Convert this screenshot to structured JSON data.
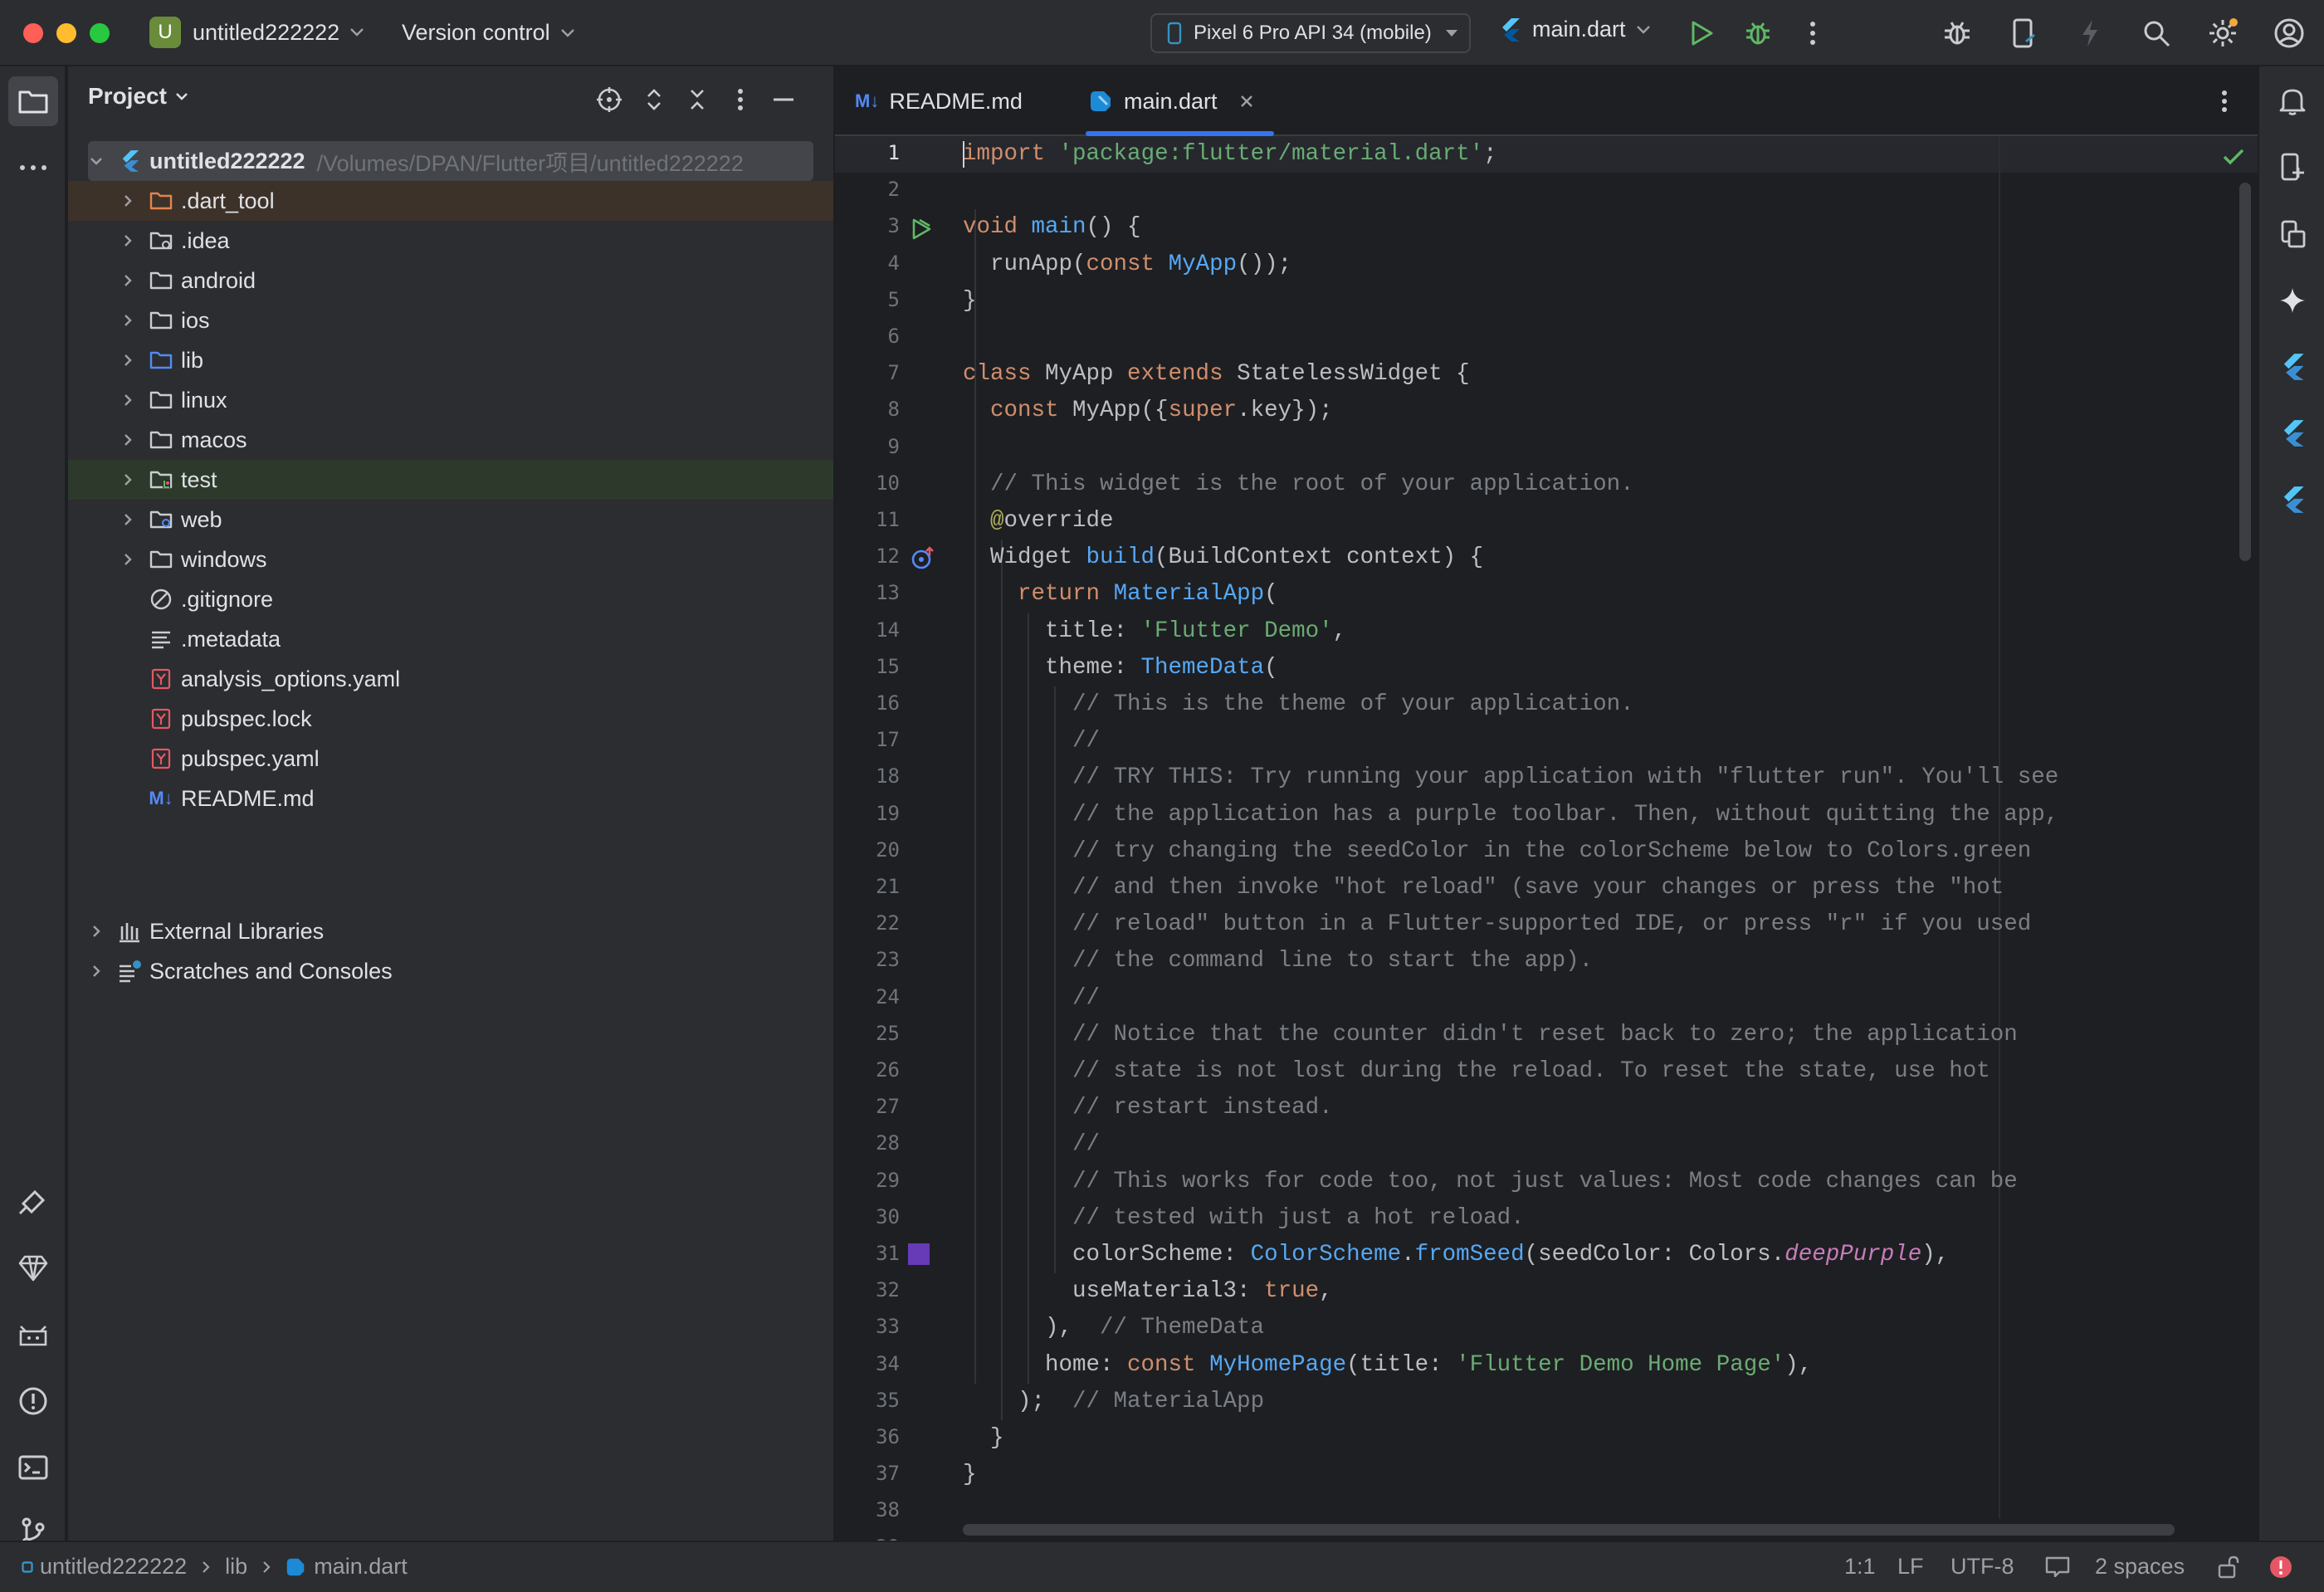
{
  "titlebar": {
    "project_initial": "U",
    "project_name": "untitled222222",
    "version_control": "Version control",
    "device": "Pixel 6 Pro API 34 (mobile)",
    "run_config": "main.dart"
  },
  "project_panel": {
    "title": "Project",
    "root": {
      "name": "untitled222222",
      "path": "/Volumes/DPAN/Flutter项目/untitled222222"
    },
    "items": [
      {
        "label": ".dart_tool",
        "icon": "folder-excluded-icon",
        "expandable": true
      },
      {
        "label": ".idea",
        "icon": "folder-settings-icon",
        "expandable": true
      },
      {
        "label": "android",
        "icon": "folder-icon",
        "expandable": true
      },
      {
        "label": "ios",
        "icon": "folder-icon",
        "expandable": true
      },
      {
        "label": "lib",
        "icon": "folder-source-icon",
        "expandable": true
      },
      {
        "label": "linux",
        "icon": "folder-icon",
        "expandable": true
      },
      {
        "label": "macos",
        "icon": "folder-icon",
        "expandable": true
      },
      {
        "label": "test",
        "icon": "folder-test-icon",
        "expandable": true
      },
      {
        "label": "web",
        "icon": "folder-web-icon",
        "expandable": true
      },
      {
        "label": "windows",
        "icon": "folder-icon",
        "expandable": true
      },
      {
        "label": ".gitignore",
        "icon": "ignore-file-icon",
        "expandable": false
      },
      {
        "label": ".metadata",
        "icon": "text-file-icon",
        "expandable": false
      },
      {
        "label": "analysis_options.yaml",
        "icon": "yaml-file-icon",
        "expandable": false
      },
      {
        "label": "pubspec.lock",
        "icon": "yaml-file-icon",
        "expandable": false
      },
      {
        "label": "pubspec.yaml",
        "icon": "yaml-file-icon",
        "expandable": false
      },
      {
        "label": "README.md",
        "icon": "markdown-file-icon",
        "expandable": false
      }
    ],
    "external_libraries": "External Libraries",
    "scratches": "Scratches and Consoles"
  },
  "editor": {
    "tabs": [
      {
        "label": "README.md",
        "icon_text": "M↓",
        "active": false
      },
      {
        "label": "main.dart",
        "active": true
      }
    ],
    "lines": [
      [
        [
          "kw",
          "import"
        ],
        [
          "",
          " "
        ],
        [
          "str",
          "'package:flutter/material.dart'"
        ],
        [
          "",
          ";"
        ]
      ],
      [],
      [
        [
          "kw",
          "void"
        ],
        [
          "",
          " "
        ],
        [
          "fn",
          "main"
        ],
        [
          "",
          "() {"
        ]
      ],
      [
        [
          "",
          "  runApp("
        ],
        [
          "kw",
          "const"
        ],
        [
          "",
          " "
        ],
        [
          "fn",
          "MyApp"
        ],
        [
          "",
          "());"
        ]
      ],
      [
        [
          "",
          "}"
        ]
      ],
      [],
      [
        [
          "kw",
          "class"
        ],
        [
          "",
          " MyApp "
        ],
        [
          "kw",
          "extends"
        ],
        [
          "",
          " StatelessWidget {"
        ]
      ],
      [
        [
          "",
          "  "
        ],
        [
          "kw",
          "const"
        ],
        [
          "",
          " MyApp({"
        ],
        [
          "kw",
          "super"
        ],
        [
          "",
          ".key});"
        ]
      ],
      [],
      [
        [
          "cm",
          "  // This widget is the root of your application."
        ]
      ],
      [
        [
          "",
          "  "
        ],
        [
          "ann",
          "@"
        ],
        [
          "",
          "override"
        ]
      ],
      [
        [
          "",
          "  Widget "
        ],
        [
          "fn",
          "build"
        ],
        [
          "",
          "(BuildContext context) {"
        ]
      ],
      [
        [
          "",
          "    "
        ],
        [
          "kw",
          "return"
        ],
        [
          "",
          " "
        ],
        [
          "fn",
          "MaterialApp"
        ],
        [
          "",
          "("
        ]
      ],
      [
        [
          "",
          "      title: "
        ],
        [
          "str",
          "'Flutter Demo'"
        ],
        [
          "",
          ","
        ]
      ],
      [
        [
          "",
          "      theme: "
        ],
        [
          "fn",
          "ThemeData"
        ],
        [
          "",
          "("
        ]
      ],
      [
        [
          "cm",
          "        // This is the theme of your application."
        ]
      ],
      [
        [
          "cm",
          "        //"
        ]
      ],
      [
        [
          "cm",
          "        // TRY THIS: Try running your application with \"flutter run\". You'll see"
        ]
      ],
      [
        [
          "cm",
          "        // the application has a purple toolbar. Then, without quitting the app,"
        ]
      ],
      [
        [
          "cm",
          "        // try changing the seedColor in the colorScheme below to Colors.green"
        ]
      ],
      [
        [
          "cm",
          "        // and then invoke \"hot reload\" (save your changes or press the \"hot"
        ]
      ],
      [
        [
          "cm",
          "        // reload\" button in a Flutter-supported IDE, or press \"r\" if you used"
        ]
      ],
      [
        [
          "cm",
          "        // the command line to start the app)."
        ]
      ],
      [
        [
          "cm",
          "        //"
        ]
      ],
      [
        [
          "cm",
          "        // Notice that the counter didn't reset back to zero; the application"
        ]
      ],
      [
        [
          "cm",
          "        // state is not lost during the reload. To reset the state, use hot"
        ]
      ],
      [
        [
          "cm",
          "        // restart instead."
        ]
      ],
      [
        [
          "cm",
          "        //"
        ]
      ],
      [
        [
          "cm",
          "        // This works for code too, not just values: Most code changes can be"
        ]
      ],
      [
        [
          "cm",
          "        // tested with just a hot reload."
        ]
      ],
      [
        [
          "",
          "        colorScheme: "
        ],
        [
          "fn",
          "ColorScheme"
        ],
        [
          "",
          "."
        ],
        [
          "fn",
          "fromSeed"
        ],
        [
          "",
          "(seedColor: Colors."
        ],
        [
          "it",
          "deepPurple"
        ],
        [
          "",
          "),"
        ]
      ],
      [
        [
          "",
          "        useMaterial3: "
        ],
        [
          "kw",
          "true"
        ],
        [
          "",
          ","
        ]
      ],
      [
        [
          "",
          "      ),  "
        ],
        [
          "hint",
          "// ThemeData"
        ]
      ],
      [
        [
          "",
          "      home: "
        ],
        [
          "kw",
          "const"
        ],
        [
          "",
          " "
        ],
        [
          "fn",
          "MyHomePage"
        ],
        [
          "",
          "(title: "
        ],
        [
          "str",
          "'Flutter Demo Home Page'"
        ],
        [
          "",
          "),"
        ]
      ],
      [
        [
          "",
          "    );  "
        ],
        [
          "hint",
          "// MaterialApp"
        ]
      ],
      [
        [
          "",
          "  }"
        ]
      ],
      [
        [
          "",
          "}"
        ]
      ],
      [],
      []
    ]
  },
  "statusbar": {
    "breadcrumb_project": "untitled222222",
    "breadcrumb_folder": "lib",
    "breadcrumb_file": "main.dart",
    "position": "1:1",
    "line_sep": "LF",
    "encoding": "UTF-8",
    "indent": "2 spaces"
  },
  "colors": {
    "keyword": "#cf8e6d",
    "string": "#6aab73",
    "function": "#56a8f5",
    "comment": "#7a7e85",
    "annotation": "#b3ae60",
    "italic": "#c77dbb",
    "seed_color_swatch": "#673ab7",
    "accent": "#3574f0"
  }
}
